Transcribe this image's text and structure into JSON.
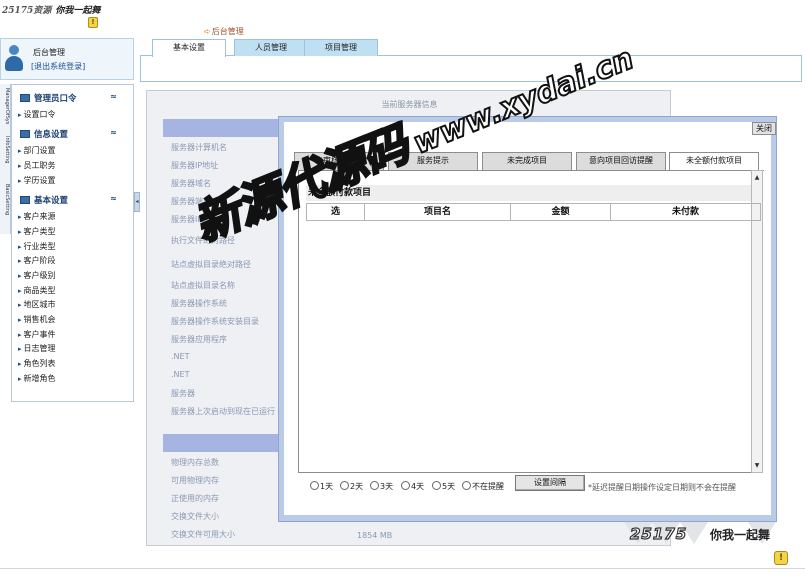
{
  "brand": {
    "top_logo_text": "25175资源",
    "top_slogan": "你我一起舞",
    "bottom_logo_num": "25175",
    "bottom_slogan": "你我一起舞",
    "hint_mark": "!"
  },
  "breadcrumb": {
    "label": "后台管理"
  },
  "tabs": [
    {
      "label": "基本设置",
      "active": true
    },
    {
      "label": "人员管理",
      "active": false
    },
    {
      "label": "项目管理",
      "active": false
    }
  ],
  "user": {
    "title": "后台管理",
    "logout": "[退出系统登录]"
  },
  "side_strip": [
    "ManagerOfSys",
    "InfoSetting",
    "BasicSetting"
  ],
  "menu": {
    "groups": [
      {
        "title": "管理员口令",
        "collapse": "≈",
        "items": [
          "设置口令"
        ]
      },
      {
        "title": "信息设置",
        "collapse": "≈",
        "items": [
          "部门设置",
          "员工职务",
          "学历设置"
        ]
      },
      {
        "title": "基本设置",
        "collapse": "≈",
        "items": [
          "客户来源",
          "客户类型",
          "行业类型",
          "客户阶段",
          "客户级别",
          "商品类型",
          "地区城市",
          "销售机会",
          "客户事件",
          "日志管理",
          "角色列表",
          "新增角色"
        ]
      }
    ],
    "splitter": "◂"
  },
  "server_info": {
    "title": "当前服务器信息",
    "labels": [
      "服务器计算机名",
      "服务器IP地址",
      "服务器域名",
      "服务器端口",
      "服务器IIS版本",
      "执行文件绝对路径",
      "站点虚拟目录绝对路径",
      "站点虚拟目录名称",
      "服务器操作系统",
      "服务器操作系统安装目录",
      "服务器应用程序",
      ".NET",
      ".NET",
      "服务器",
      "服务器上次启动到现在已运行"
    ],
    "labels2": [
      "物理内存总数",
      "可用物理内存",
      "正使用的内存",
      "交换文件大小",
      "交换文件可用大小"
    ],
    "swap_free_value": "1854 MB"
  },
  "dialog": {
    "close": "关闭",
    "tabs": [
      {
        "label": "未审核的项目",
        "active": false
      },
      {
        "label": "服务提示",
        "active": false
      },
      {
        "label": "未完成项目",
        "active": false
      },
      {
        "label": "意向项目回访提醒",
        "active": false
      },
      {
        "label": "未全额付款项目",
        "active": true
      }
    ],
    "section_title": "未全额付款项目",
    "columns": [
      "选",
      "项目名",
      "金额",
      "未付款"
    ],
    "scroll_up": "▲",
    "scroll_down": "▼",
    "radios": [
      "1天",
      "2天",
      "3天",
      "4天",
      "5天",
      "不在提醒"
    ],
    "set_button": "设置间隔",
    "hint": "*延迟提醒日期操作设定日期则不会在提醒"
  },
  "watermark": {
    "cn": "新源代源码",
    "en": "www.xydai.cn"
  }
}
